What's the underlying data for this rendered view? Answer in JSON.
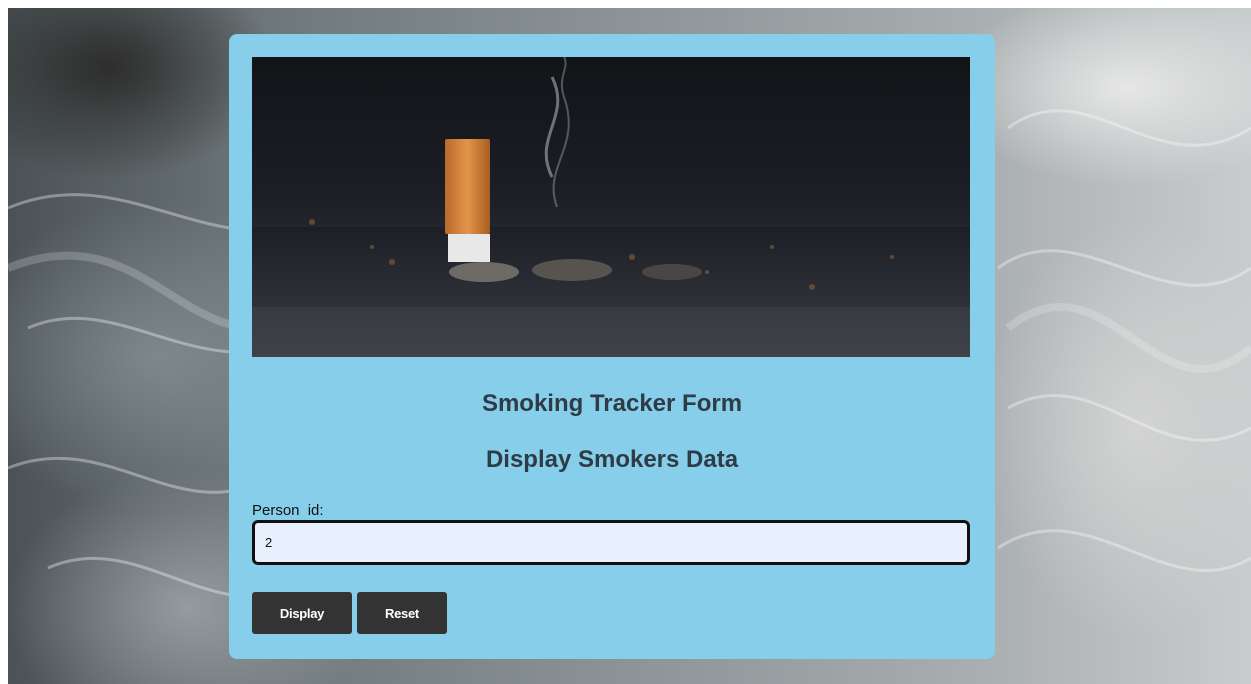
{
  "header": {
    "title": "Smoking Tracker Form",
    "subtitle": "Display Smokers Data"
  },
  "form": {
    "person_id_label": "Person  id:",
    "person_id_value": "2"
  },
  "buttons": {
    "display_label": "Display",
    "reset_label": "Reset"
  },
  "colors": {
    "card_background": "#87ceeb",
    "button_background": "#333333",
    "input_background": "#e8f0fe"
  }
}
